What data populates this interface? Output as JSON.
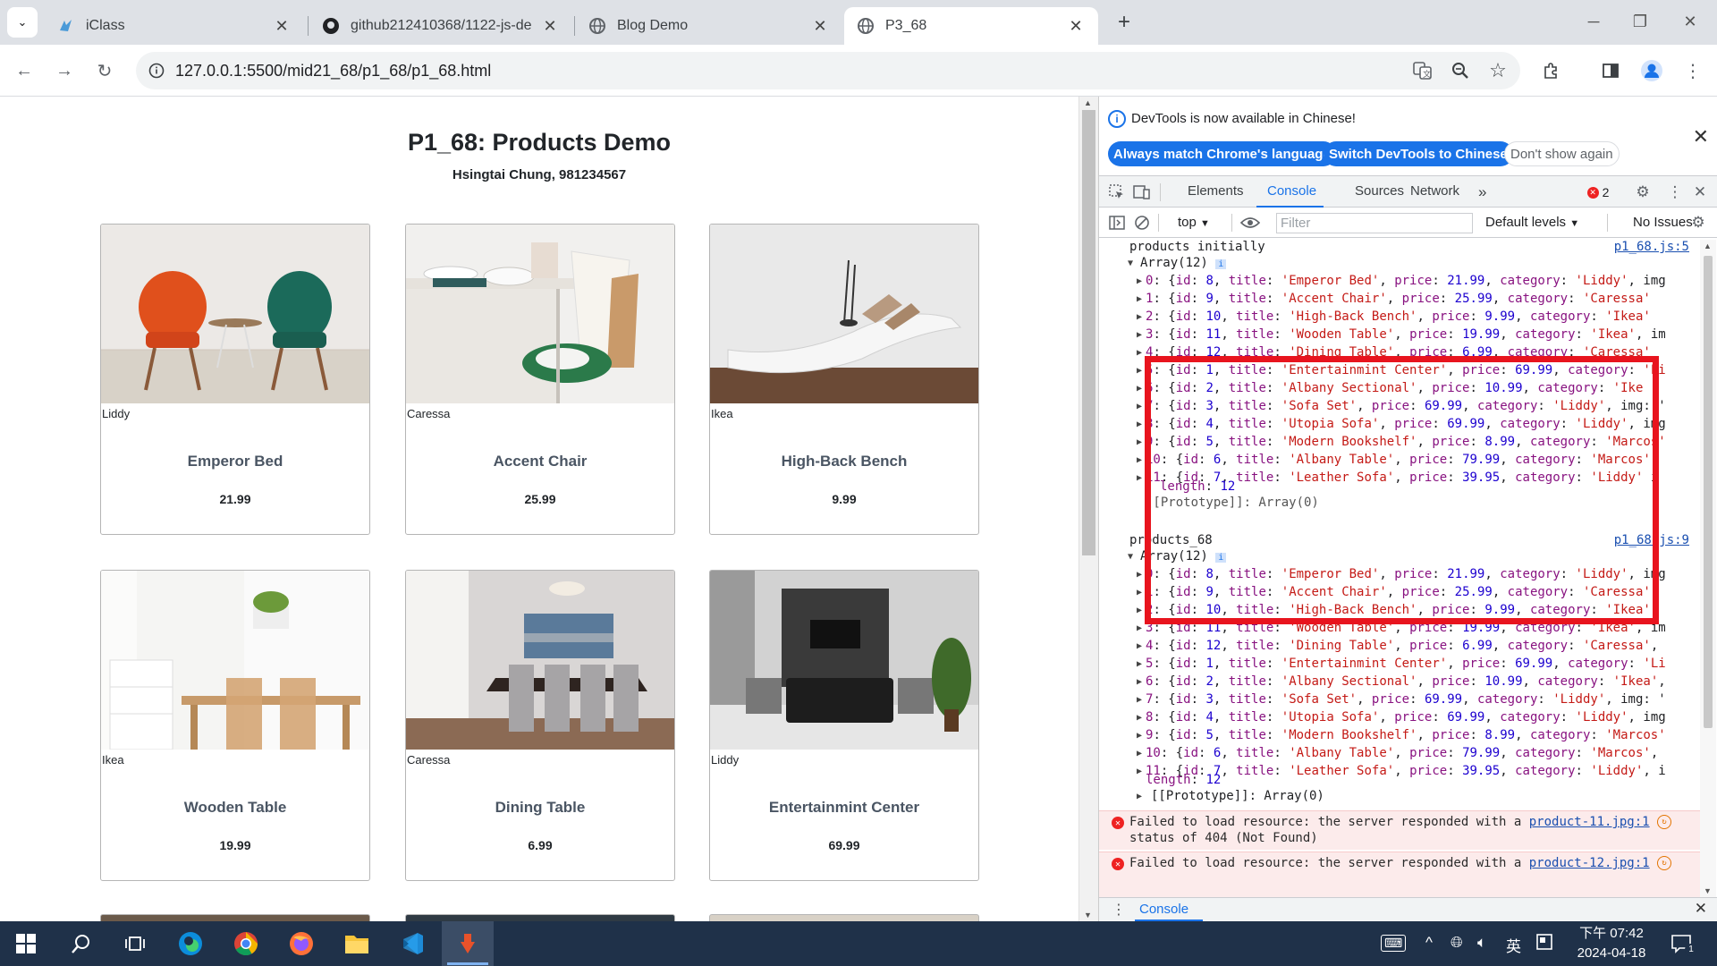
{
  "browser": {
    "tabs": [
      {
        "label": "iClass",
        "icon": "iclass-icon"
      },
      {
        "label": "github212410368/1122-js-de",
        "icon": "github-icon"
      },
      {
        "label": "Blog Demo",
        "icon": "globe-icon"
      },
      {
        "label": "P3_68",
        "icon": "globe-icon"
      }
    ],
    "url": "127.0.0.1:5500/mid21_68/p1_68/p1_68.html"
  },
  "page": {
    "title": "P1_68: Products Demo",
    "subtitle": "Hsingtai Chung, 981234567",
    "products": [
      {
        "category": "Liddy",
        "title": "Emperor Bed",
        "price": "21.99"
      },
      {
        "category": "Caressa",
        "title": "Accent Chair",
        "price": "25.99"
      },
      {
        "category": "Ikea",
        "title": "High-Back Bench",
        "price": "9.99"
      },
      {
        "category": "Ikea",
        "title": "Wooden Table",
        "price": "19.99"
      },
      {
        "category": "Caressa",
        "title": "Dining Table",
        "price": "6.99"
      },
      {
        "category": "Liddy",
        "title": "Entertainmint Center",
        "price": "69.99"
      }
    ]
  },
  "devtools": {
    "info_message": "DevTools is now available in Chinese!",
    "btn_match": "Always match Chrome's language",
    "btn_switch": "Switch DevTools to Chinese",
    "btn_dont": "Don't show again",
    "tabs": [
      "Elements",
      "Console",
      "Sources",
      "Network"
    ],
    "more_tabs": "»",
    "error_count": "2",
    "context": "top",
    "filter_placeholder": "Filter",
    "levels": "Default levels",
    "issues": "No Issues",
    "log1_label": "products initially",
    "log1_src": "p1_68.js:5",
    "log2_label": "products_68",
    "log2_src": "p1_68.js:9",
    "array_label": "Array(12)",
    "rows1": [
      {
        "i": "0",
        "id": "8",
        "title": "'Emperor Bed'",
        "price": "21.99",
        "cat": "'Liddy'",
        "tail": ", img"
      },
      {
        "i": "1",
        "id": "9",
        "title": "'Accent Chair'",
        "price": "25.99",
        "cat": "'Caressa'",
        "tail": ""
      },
      {
        "i": "2",
        "id": "10",
        "title": "'High-Back Bench'",
        "price": "9.99",
        "cat": "'Ikea'",
        "tail": ""
      },
      {
        "i": "3",
        "id": "11",
        "title": "'Wooden Table'",
        "price": "19.99",
        "cat": "'Ikea'",
        "tail": ", im"
      },
      {
        "i": "4",
        "id": "12",
        "title": "'Dining Table'",
        "price": "6.99",
        "cat": "'Caressa'",
        "tail": ""
      },
      {
        "i": "5",
        "id": "1",
        "title": "'Entertainmint Center'",
        "price": "69.99",
        "cat": "'Li",
        "tail": ""
      },
      {
        "i": "6",
        "id": "2",
        "title": "'Albany Sectional'",
        "price": "10.99",
        "cat": "'Ike",
        "tail": ""
      },
      {
        "i": "7",
        "id": "3",
        "title": "'Sofa Set'",
        "price": "69.99",
        "cat": "'Liddy'",
        "tail": ", img: '"
      },
      {
        "i": "8",
        "id": "4",
        "title": "'Utopia Sofa'",
        "price": "69.99",
        "cat": "'Liddy'",
        "tail": ", img"
      },
      {
        "i": "9",
        "id": "5",
        "title": "'Modern Bookshelf'",
        "price": "8.99",
        "cat": "'Marcos'",
        "tail": ""
      },
      {
        "i": "10",
        "id": "6",
        "title": "'Albany Table'",
        "price": "79.99",
        "cat": "'Marcos'",
        "tail": ""
      },
      {
        "i": "11",
        "id": "7",
        "title": "'Leather Sofa'",
        "price": "39.95",
        "cat": "'Liddy'",
        "tail": " i"
      }
    ],
    "rows2": [
      {
        "i": "0",
        "id": "8",
        "title": "'Emperor Bed'",
        "price": "21.99",
        "cat": "'Liddy'",
        "tail": ", img"
      },
      {
        "i": "1",
        "id": "9",
        "title": "'Accent Chair'",
        "price": "25.99",
        "cat": "'Caressa'",
        "tail": ","
      },
      {
        "i": "2",
        "id": "10",
        "title": "'High-Back Bench'",
        "price": "9.99",
        "cat": "'Ikea'",
        "tail": ","
      },
      {
        "i": "3",
        "id": "11",
        "title": "'Wooden Table'",
        "price": "19.99",
        "cat": "'Ikea'",
        "tail": ", im"
      },
      {
        "i": "4",
        "id": "12",
        "title": "'Dining Table'",
        "price": "6.99",
        "cat": "'Caressa'",
        "tail": ","
      },
      {
        "i": "5",
        "id": "1",
        "title": "'Entertainmint Center'",
        "price": "69.99",
        "cat": "'Li",
        "tail": ""
      },
      {
        "i": "6",
        "id": "2",
        "title": "'Albany Sectional'",
        "price": "10.99",
        "cat": "'Ikea'",
        "tail": ","
      },
      {
        "i": "7",
        "id": "3",
        "title": "'Sofa Set'",
        "price": "69.99",
        "cat": "'Liddy'",
        "tail": ", img: '"
      },
      {
        "i": "8",
        "id": "4",
        "title": "'Utopia Sofa'",
        "price": "69.99",
        "cat": "'Liddy'",
        "tail": ", img"
      },
      {
        "i": "9",
        "id": "5",
        "title": "'Modern Bookshelf'",
        "price": "8.99",
        "cat": "'Marcos'",
        "tail": ""
      },
      {
        "i": "10",
        "id": "6",
        "title": "'Albany Table'",
        "price": "79.99",
        "cat": "'Marcos'",
        "tail": ","
      },
      {
        "i": "11",
        "id": "7",
        "title": "'Leather Sofa'",
        "price": "39.95",
        "cat": "'Liddy'",
        "tail": ", i"
      }
    ],
    "length_label": "length: 12",
    "proto_label": "[[Prototype]]: Array(0)",
    "error1_text": "Failed to load resource: the server responded with a",
    "error1_link": "product-11.jpg:1",
    "error1_status": "status of 404 (Not Found)",
    "error2_text": "Failed to load resource: the server responded with a",
    "error2_link": "product-12.jpg:1",
    "drawer_tab": "Console",
    "highlight_color": "#e8141e"
  },
  "taskbar": {
    "time": "下午 07:42",
    "date": "2024-04-18",
    "ime": "英",
    "notif_count": "1"
  }
}
